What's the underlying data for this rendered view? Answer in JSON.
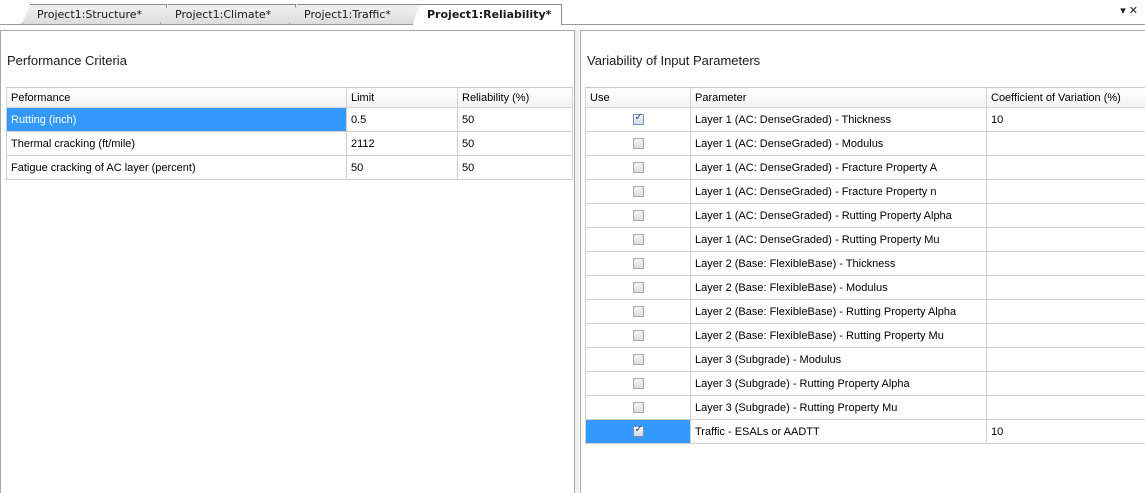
{
  "tabs": [
    {
      "label": "Project1:Structure*"
    },
    {
      "label": "Project1:Climate*"
    },
    {
      "label": "Project1:Traffic*"
    },
    {
      "label": "Project1:Reliability*"
    }
  ],
  "window_controls": {
    "dropdown_glyph": "▾",
    "close_glyph": "✕"
  },
  "left": {
    "title": "Performance Criteria",
    "columns": [
      "Peformance",
      "Limit",
      "Reliability (%)"
    ],
    "rows": [
      {
        "performance": "Rutting (inch)",
        "limit": "0.5",
        "reliability": "50"
      },
      {
        "performance": "Thermal cracking (ft/mile)",
        "limit": "2112",
        "reliability": "50"
      },
      {
        "performance": "Fatigue cracking of AC layer (percent)",
        "limit": "50",
        "reliability": "50"
      }
    ]
  },
  "right": {
    "title": "Variability of Input Parameters",
    "columns": [
      "Use",
      "Parameter",
      "Coefficient of Variation (%)"
    ],
    "rows": [
      {
        "use": true,
        "parameter": "Layer 1 (AC: DenseGraded) - Thickness",
        "cov": "10"
      },
      {
        "use": false,
        "parameter": "Layer 1 (AC: DenseGraded) - Modulus",
        "cov": ""
      },
      {
        "use": false,
        "parameter": "Layer 1 (AC: DenseGraded) - Fracture Property A",
        "cov": ""
      },
      {
        "use": false,
        "parameter": "Layer 1 (AC: DenseGraded) - Fracture Property n",
        "cov": ""
      },
      {
        "use": false,
        "parameter": "Layer 1 (AC: DenseGraded) - Rutting Property Alpha",
        "cov": ""
      },
      {
        "use": false,
        "parameter": "Layer 1 (AC: DenseGraded) - Rutting Property Mu",
        "cov": ""
      },
      {
        "use": false,
        "parameter": "Layer 2 (Base: FlexibleBase) - Thickness",
        "cov": ""
      },
      {
        "use": false,
        "parameter": "Layer 2 (Base: FlexibleBase) - Modulus",
        "cov": ""
      },
      {
        "use": false,
        "parameter": "Layer 2 (Base: FlexibleBase) - Rutting Property Alpha",
        "cov": ""
      },
      {
        "use": false,
        "parameter": "Layer 2 (Base: FlexibleBase) - Rutting Property Mu",
        "cov": ""
      },
      {
        "use": false,
        "parameter": "Layer 3 (Subgrade) - Modulus",
        "cov": ""
      },
      {
        "use": false,
        "parameter": "Layer 3 (Subgrade) - Rutting Property Alpha",
        "cov": ""
      },
      {
        "use": false,
        "parameter": "Layer 3 (Subgrade) - Rutting Property Mu",
        "cov": ""
      },
      {
        "use": true,
        "parameter": "Traffic - ESALs or AADTT",
        "cov": "10"
      }
    ]
  }
}
